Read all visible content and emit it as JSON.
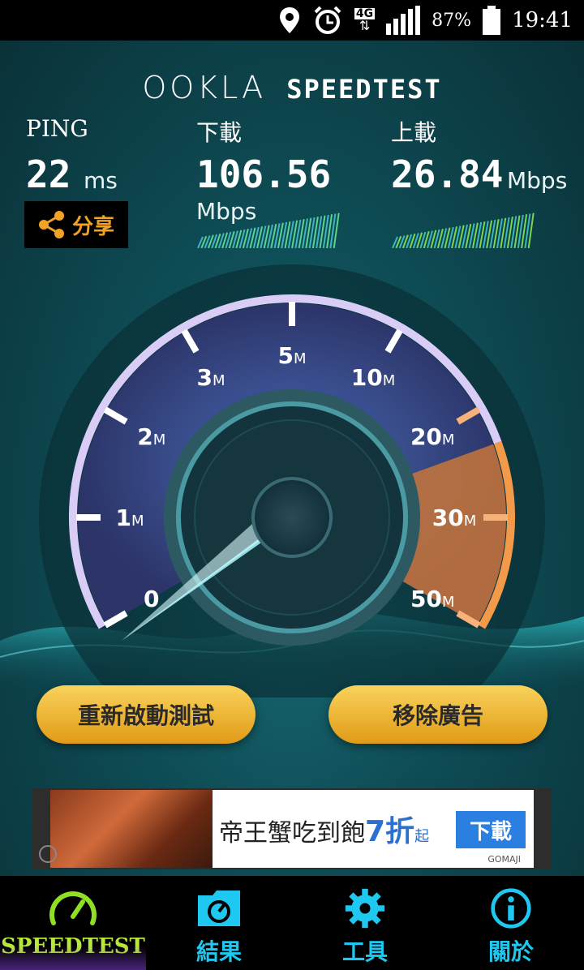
{
  "status_bar": {
    "network": "4G",
    "battery": "87%",
    "time": "19:41",
    "icons": [
      "location-icon",
      "alarm-icon",
      "signal-icon",
      "battery-icon"
    ]
  },
  "header": {
    "brand": "OOKLA",
    "product": "SPEEDTEST"
  },
  "ping": {
    "label": "PING",
    "value": "22",
    "unit": "ms"
  },
  "download": {
    "label": "下載",
    "value": "106.56",
    "unit": "Mbps"
  },
  "upload": {
    "label": "上載",
    "value": "26.84",
    "unit": "Mbps"
  },
  "share": {
    "label": "分享",
    "icon": "share-icon"
  },
  "gauge": {
    "ticks": [
      {
        "num": "0",
        "unit": ""
      },
      {
        "num": "1",
        "unit": "M"
      },
      {
        "num": "2",
        "unit": "M"
      },
      {
        "num": "3",
        "unit": "M"
      },
      {
        "num": "5",
        "unit": "M"
      },
      {
        "num": "10",
        "unit": "M"
      },
      {
        "num": "20",
        "unit": "M"
      },
      {
        "num": "30",
        "unit": "M"
      },
      {
        "num": "50",
        "unit": "M"
      }
    ]
  },
  "actions": {
    "restart": "重新啟動測試",
    "remove_ads": "移除廣告"
  },
  "ad": {
    "text": "帝王蟹吃到飽",
    "highlight": "7折",
    "suffix": "起",
    "cta": "下載",
    "brand": "GOMAJI"
  },
  "nav": {
    "items": [
      {
        "label": "SPEEDTEST",
        "icon": "speedometer-icon",
        "active": true
      },
      {
        "label": "結果",
        "icon": "results-folder-icon",
        "active": false
      },
      {
        "label": "工具",
        "icon": "gear-icon",
        "active": false
      },
      {
        "label": "關於",
        "icon": "info-icon",
        "active": false
      }
    ]
  },
  "colors": {
    "accent_orange": "#f2a224",
    "nav_blue": "#1ec8f0",
    "nav_active": "#b7e83a",
    "download_bars": "#5fd38a",
    "upload_bars": "#7ed64c"
  }
}
